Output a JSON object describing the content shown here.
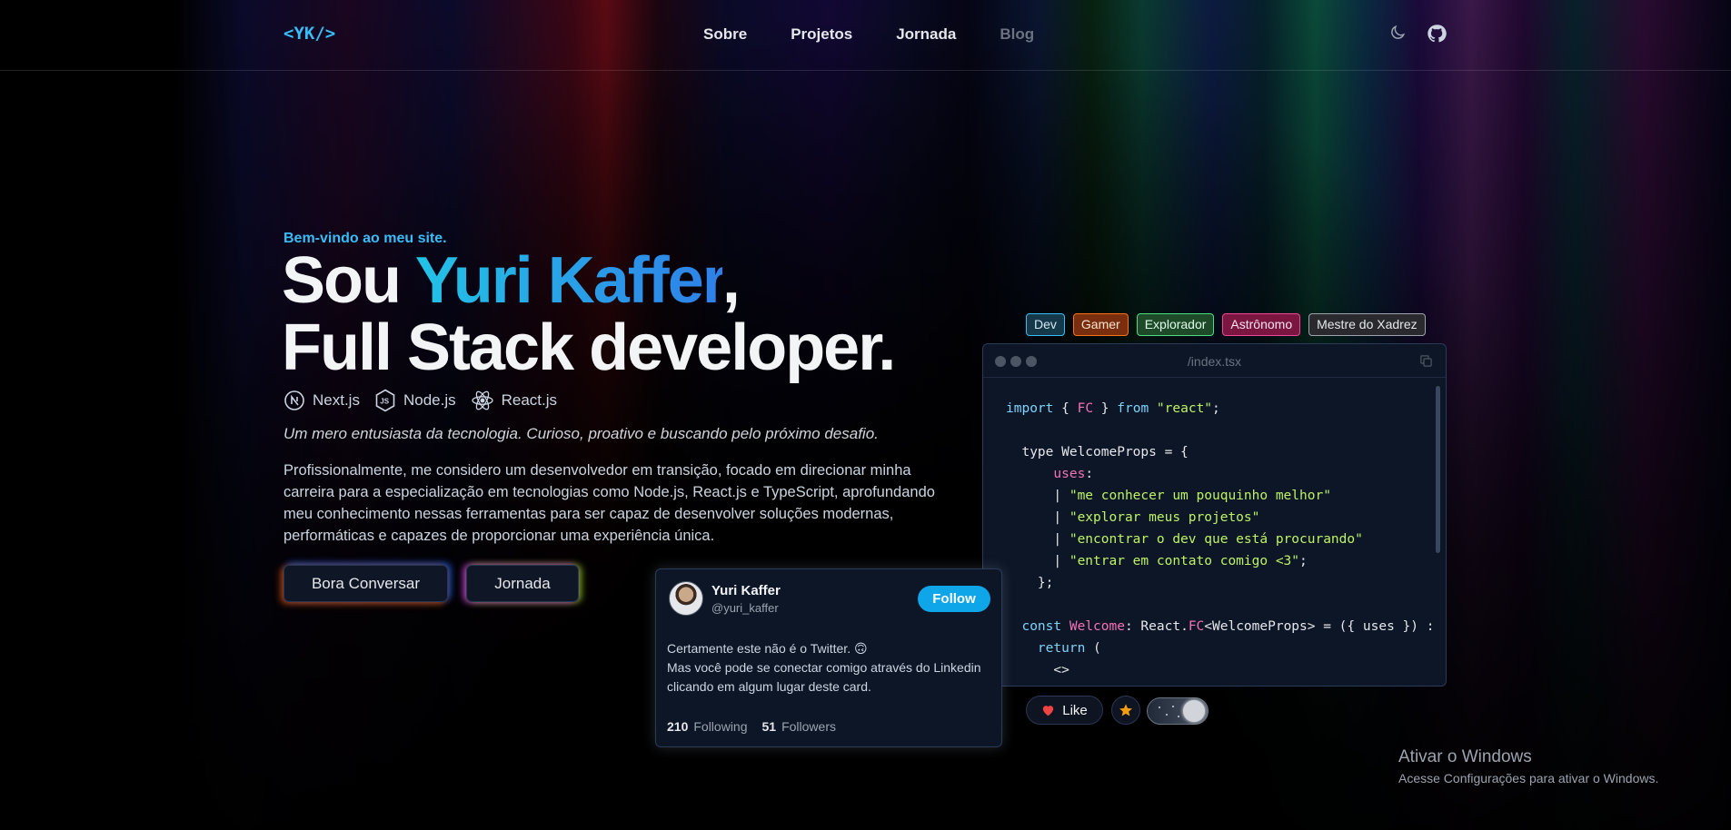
{
  "nav": {
    "logo": "<YK/>",
    "links": [
      "Sobre",
      "Projetos",
      "Jornada",
      "Blog"
    ]
  },
  "hero": {
    "welcome": "Bem-vindo ao meu site.",
    "title_prefix": "Sou ",
    "title_name": "Yuri Kaffer",
    "title_comma": ",",
    "title_line2": "Full Stack developer.",
    "stack": [
      "Next.js",
      "Node.js",
      "React.js"
    ],
    "tagline": "Um mero entusiasta da tecnologia. Curioso, proativo e buscando pelo próximo desafio.",
    "paragraph": "Profissionalmente, me considero um desenvolvedor em transição, focado em direcionar minha carreira para a especialização em tecnologias como Node.js, React.js e TypeScript, aprofundando meu conhecimento nessas ferramentas para ser capaz de desenvolver soluções modernas, performáticas e capazes de proporcionar uma experiência única.",
    "btn_contact": "Bora Conversar",
    "btn_journey": "Jornada"
  },
  "tags": [
    "Dev",
    "Gamer",
    "Explorador",
    "Astrônomo",
    "Mestre do Xadrez"
  ],
  "code": {
    "filename": "/index.tsx",
    "uses": [
      "\"me conhecer um pouquinho melhor\"",
      "\"explorar meus projetos\"",
      "\"encontrar o dev que está procurando\"",
      "\"entrar em contato comigo <3\""
    ]
  },
  "reactions": {
    "like": "Like"
  },
  "twitter": {
    "name": "Yuri Kaffer",
    "handle": "@yuri_kaffer",
    "follow": "Follow",
    "line1": "Certamente este não é o Twitter. 🙃",
    "line2": "Mas você pode se conectar comigo através do Linkedin clicando em algum lugar deste card.",
    "following_count": "210",
    "following_label": "Following",
    "followers_count": "51",
    "followers_label": "Followers"
  },
  "watermark": {
    "title": "Ativar o Windows",
    "subtitle": "Acesse Configurações para ativar o Windows."
  },
  "colors": {
    "accent": "#38bdf8",
    "follow": "#0ea5e9",
    "background": "#000000"
  }
}
